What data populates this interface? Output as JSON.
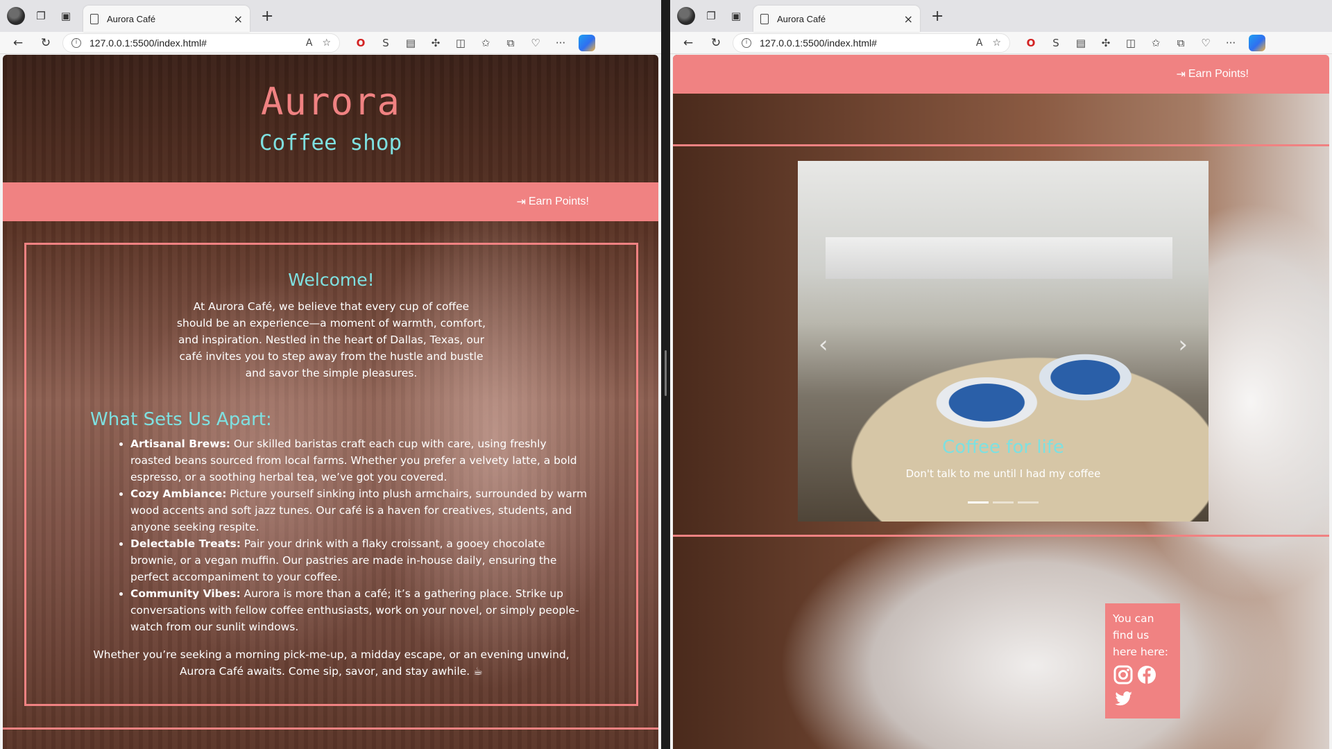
{
  "browser": {
    "tab_title": "Aurora Café",
    "url": "127.0.0.1:5500/index.html#",
    "tab_close": "×",
    "new_tab": "+"
  },
  "left_page": {
    "brand": "Aurora",
    "tagline": "Coffee shop",
    "nav_link": "Earn Points!",
    "welcome_title": "Welcome!",
    "intro": "At Aurora Café, we believe that every cup of coffee should be an experience—a moment of warmth, comfort, and inspiration. Nestled in the heart of Dallas, Texas, our café invites you to step away from the hustle and bustle and savor the simple pleasures.",
    "apart_title": "What Sets Us Apart:",
    "features": [
      {
        "title": "Artisanal Brews:",
        "text": " Our skilled baristas craft each cup with care, using freshly roasted beans sourced from local farms. Whether you prefer a velvety latte, a bold espresso, or a soothing herbal tea, we’ve got you covered."
      },
      {
        "title": "Cozy Ambiance:",
        "text": " Picture yourself sinking into plush armchairs, surrounded by warm wood accents and soft jazz tunes. Our café is a haven for creatives, students, and anyone seeking respite."
      },
      {
        "title": "Delectable Treats:",
        "text": " Pair your drink with a flaky croissant, a gooey chocolate brownie, or a vegan muffin. Our pastries are made in-house daily, ensuring the perfect accompaniment to your coffee."
      },
      {
        "title": "Community Vibes:",
        "text": " Aurora is more than a café; it’s a gathering place. Strike up conversations with fellow coffee enthusiasts, work on your novel, or simply people-watch from our sunlit windows."
      }
    ],
    "closing": "Whether you’re seeking a morning pick-me-up, a midday escape, or an evening unwind, Aurora Café awaits. Come sip, savor, and stay awhile. ☕"
  },
  "right_page": {
    "nav_link": "Earn Points!",
    "carousel": {
      "caption_title": "Coffee for life",
      "caption_text": "Don't talk to me until I had my coffee",
      "slide_count": 3,
      "active_slide": 1
    },
    "find_us": "You can find us here here:",
    "socials": [
      "instagram-icon",
      "facebook-icon",
      "twitter-icon"
    ]
  },
  "colors": {
    "accent": "#f08282",
    "heading": "#7ee0e0"
  }
}
